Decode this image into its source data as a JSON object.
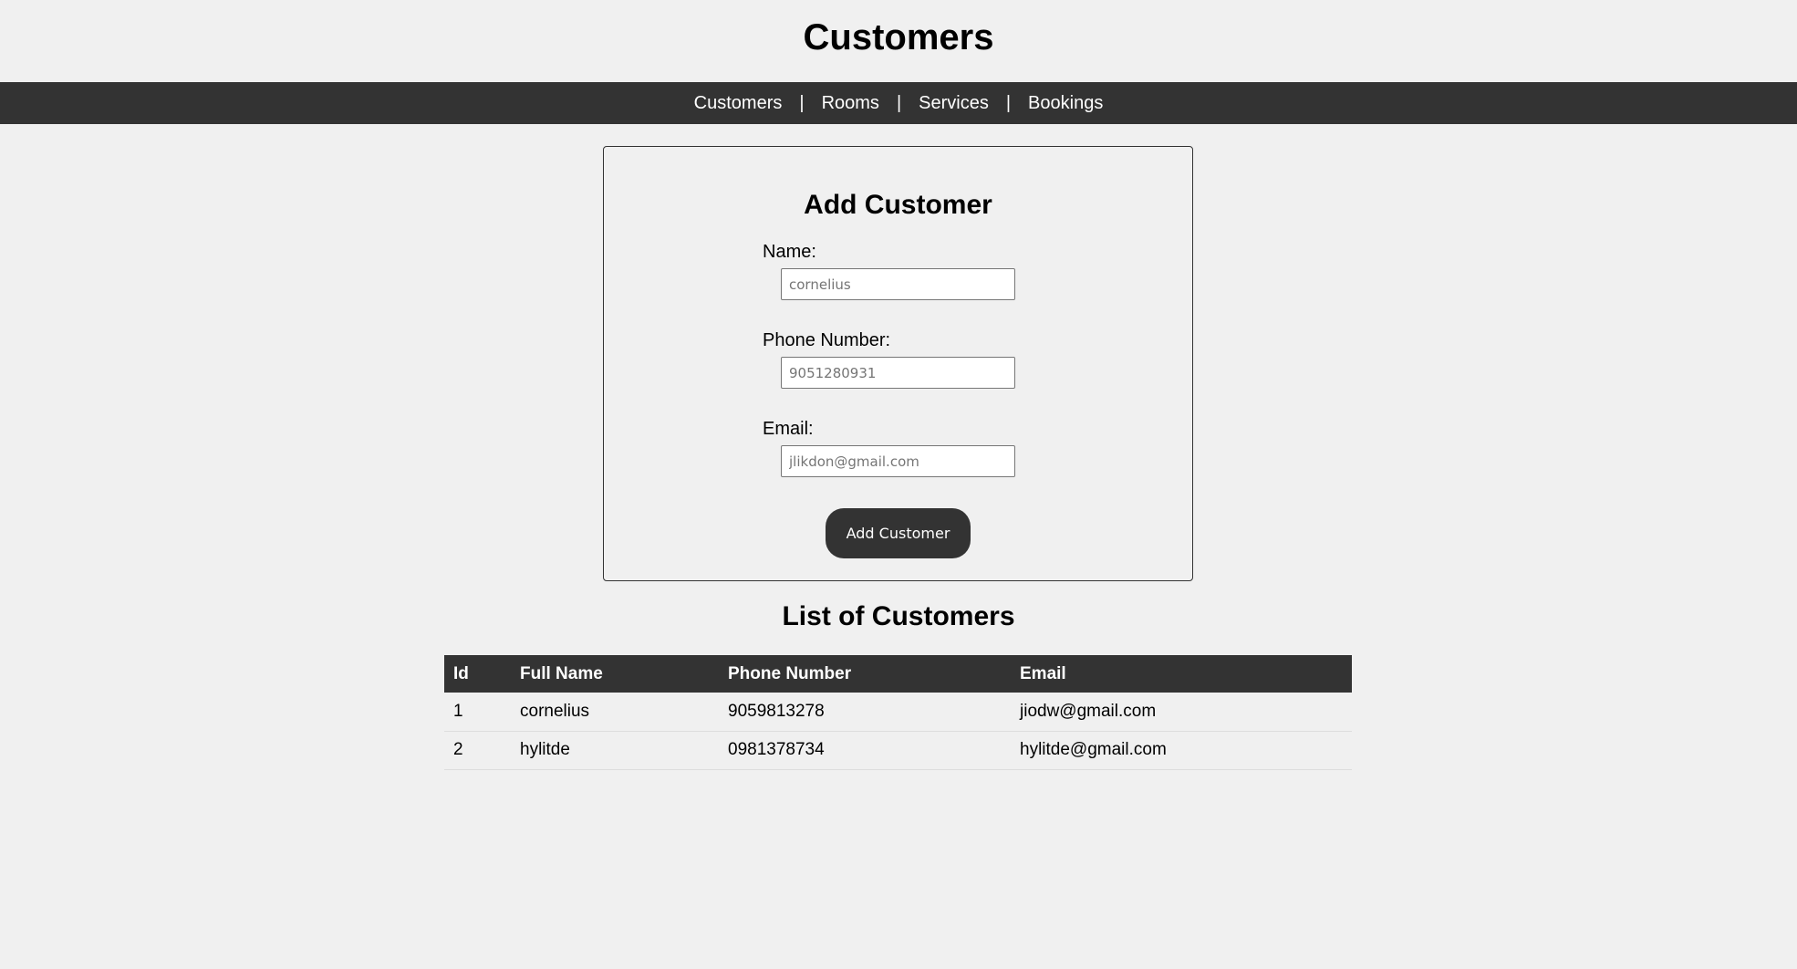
{
  "header": {
    "title": "Customers"
  },
  "nav": {
    "items": [
      {
        "label": "Customers"
      },
      {
        "label": "Rooms"
      },
      {
        "label": "Services"
      },
      {
        "label": "Bookings"
      }
    ],
    "separator": "|"
  },
  "form": {
    "title": "Add Customer",
    "name_label": "Name:",
    "name_placeholder": "cornelius",
    "phone_label": "Phone Number:",
    "phone_placeholder": "9051280931",
    "email_label": "Email:",
    "email_placeholder": "jlikdon@gmail.com",
    "submit_label": "Add Customer"
  },
  "list": {
    "title": "List of Customers",
    "columns": [
      "Id",
      "Full Name",
      "Phone Number",
      "Email"
    ],
    "rows": [
      {
        "id": "1",
        "name": "cornelius",
        "phone": "9059813278",
        "email": "jiodw@gmail.com"
      },
      {
        "id": "2",
        "name": "hylitde",
        "phone": "0981378734",
        "email": "hylitde@gmail.com"
      }
    ]
  },
  "colors": {
    "background": "#f0f0f0",
    "dark": "#333333",
    "text_light": "#ffffff"
  }
}
